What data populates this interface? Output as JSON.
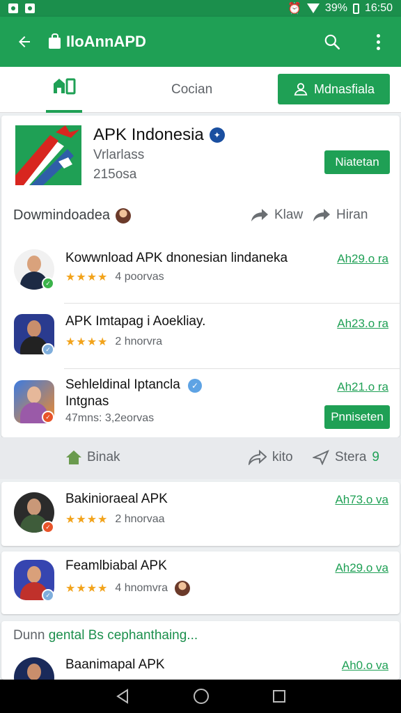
{
  "colors": {
    "primary": "#1fa055",
    "statusbar": "#1b8f4c",
    "star": "#f2a31b"
  },
  "statusbar": {
    "battery": "39%",
    "time": "16:50"
  },
  "appbar": {
    "title": "IloAnnAPD",
    "icons": [
      "back-arrow-icon",
      "bag-icon",
      "search-icon",
      "more-vert-icon"
    ]
  },
  "tabs": {
    "second": "Cocian",
    "button": "Mdnasfiala"
  },
  "app": {
    "name": "APK Indonesia",
    "subtitle": "Vrlarlass",
    "size": "215osa",
    "action": "Niatetan"
  },
  "downloads": {
    "title": "Dowmindoadea",
    "share1": "Klaw",
    "share2": "Hiran",
    "items": [
      {
        "title": "Kowwnload APK dnonesian lindaneka",
        "rating": "★★★★",
        "meta": "4 poorvas",
        "price": "Ah29.o ra"
      },
      {
        "title": "APK Imtapag i Aoekliay.",
        "rating": "★★★★",
        "meta": "2 hnorvra",
        "price": "Ah23.o ra"
      },
      {
        "title": "Sehleldinal Iptancla",
        "title2": "Intgnas",
        "rating": "",
        "meta": "47mns: 3,2eorvas",
        "price": "Ah21.o ra",
        "action": "Pnniseten"
      }
    ]
  },
  "strip": {
    "home": "Binak",
    "share": "kito",
    "stera": "Stera",
    "stera_extra": "9"
  },
  "items2": [
    {
      "title": "Bakinioraeal APK",
      "rating": "★★★★",
      "meta": "2 hnorvaa",
      "price": "Ah73.o va"
    },
    {
      "title": "Feamlbiabal APK",
      "rating": "★★★★",
      "meta": "4 hnomvra",
      "price": "Ah29.o va"
    }
  ],
  "more": {
    "prefix": "Dunn",
    "rest": "gental Bs cephanthaing...",
    "item_title": "Baanimapal APK",
    "item_price": "Ah0.o va"
  }
}
